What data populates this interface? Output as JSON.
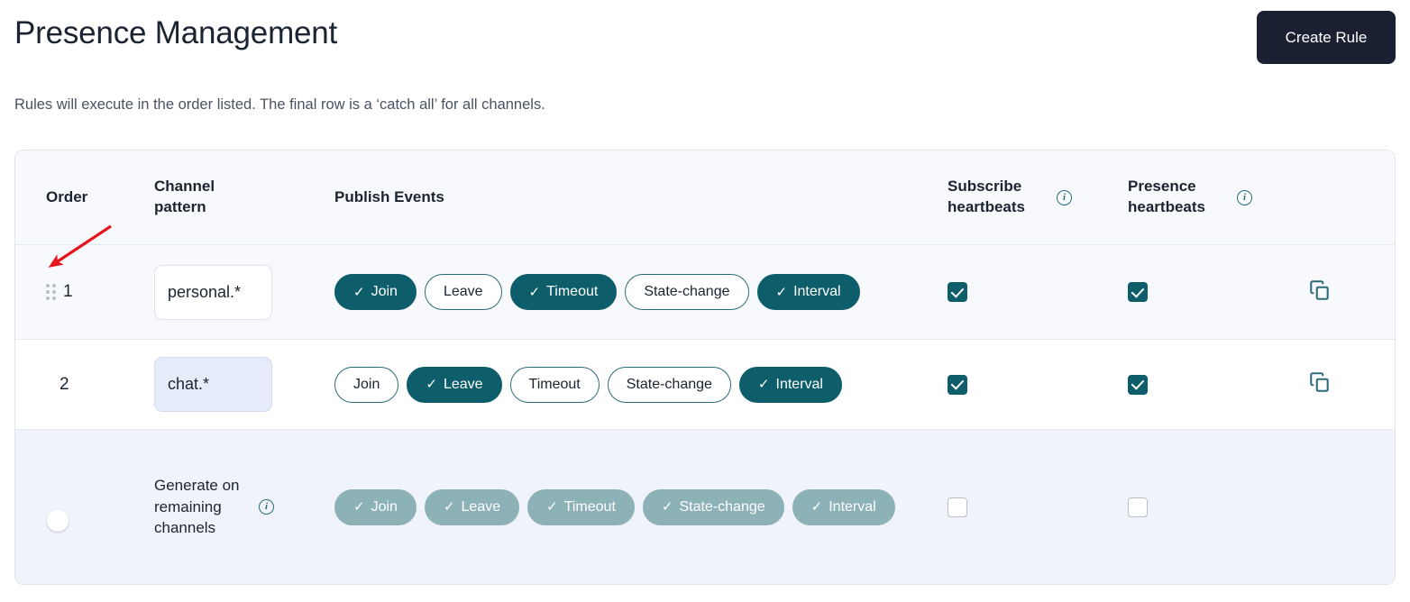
{
  "header": {
    "title": "Presence Management",
    "create_button_label": "Create Rule"
  },
  "subtitle": "Rules will execute in the order listed. The final row is a ‘catch all’ for all channels.",
  "table": {
    "columns": {
      "order": "Order",
      "channel_pattern": "Channel pattern",
      "publish_events": "Publish Events",
      "subscribe_heartbeats": "Subscribe heartbeats",
      "presence_heartbeats": "Presence heartbeats"
    },
    "info_icon_glyph": "i",
    "rows": [
      {
        "order": "1",
        "drag_handle": "drag-handle-icon",
        "pattern_value": "personal.*",
        "pattern_focused": false,
        "events": [
          {
            "label": "Join",
            "selected": true
          },
          {
            "label": "Leave",
            "selected": false
          },
          {
            "label": "Timeout",
            "selected": true
          },
          {
            "label": "State-change",
            "selected": false
          },
          {
            "label": "Interval",
            "selected": true
          }
        ],
        "subscribe_heartbeats": true,
        "presence_heartbeats": true,
        "has_copy_action": true
      },
      {
        "order": "2",
        "pattern_value": "chat.*",
        "pattern_focused": true,
        "events": [
          {
            "label": "Join",
            "selected": false
          },
          {
            "label": "Leave",
            "selected": true
          },
          {
            "label": "Timeout",
            "selected": false
          },
          {
            "label": "State-change",
            "selected": false
          },
          {
            "label": "Interval",
            "selected": true
          }
        ],
        "subscribe_heartbeats": true,
        "presence_heartbeats": true,
        "has_copy_action": true
      },
      {
        "order": "",
        "toggle_on": false,
        "pattern_label": "Generate on remaining channels",
        "catch_all": true,
        "events": [
          {
            "label": "Join",
            "selected": true,
            "disabled": true
          },
          {
            "label": "Leave",
            "selected": true,
            "disabled": true
          },
          {
            "label": "Timeout",
            "selected": true,
            "disabled": true
          },
          {
            "label": "State-change",
            "selected": true,
            "disabled": true
          },
          {
            "label": "Interval",
            "selected": true,
            "disabled": true
          }
        ],
        "subscribe_heartbeats": false,
        "presence_heartbeats": false,
        "has_copy_action": false
      }
    ]
  },
  "annotation": {
    "type": "arrow",
    "color": "#e8141b",
    "points_to": "drag-handle-row-1"
  },
  "colors": {
    "accent_teal": "#0d5d6b",
    "accent_teal_disabled": "#8cb2b8",
    "button_dark": "#1b2133",
    "row_highlight": "#f8f9fc",
    "row_catchall": "#f0f3f9",
    "input_focused": "#e6ecf9",
    "annotation_red": "#e8141b"
  }
}
